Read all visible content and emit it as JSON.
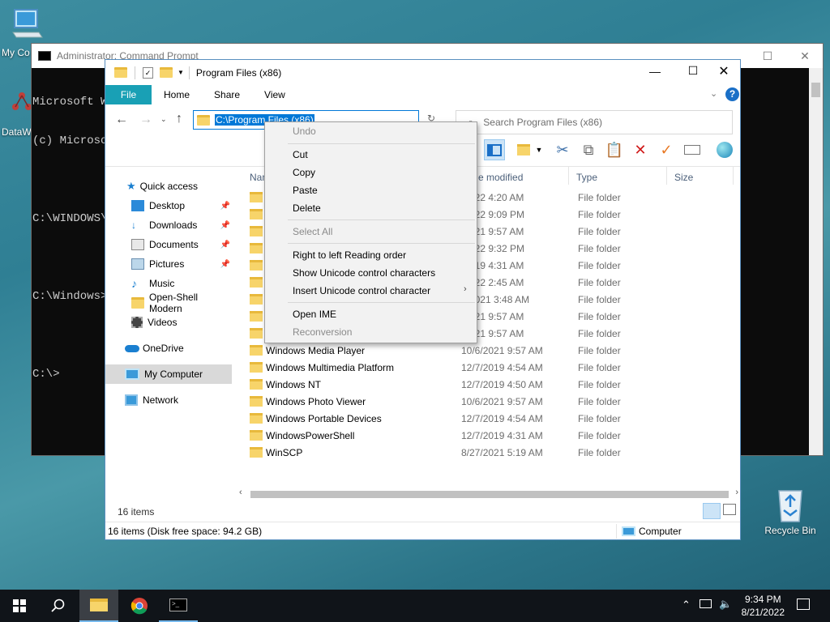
{
  "desktop": {
    "icons": [
      {
        "label": "My Co"
      },
      {
        "label": "DataW"
      },
      {
        "label": "Recycle Bin"
      }
    ]
  },
  "cmd": {
    "title": "Administrator: Command Prompt",
    "lines": [
      "Microsoft W",
      "(c) Microso",
      "",
      "C:\\WINDOWS\\s",
      "",
      "C:\\Windows>c",
      "",
      "C:\\>"
    ]
  },
  "explorer": {
    "title": "Program Files (x86)",
    "tabs": [
      "File",
      "Home",
      "Share",
      "View"
    ],
    "address_text": "C:\\Program Files (x86)",
    "search_placeholder": "Search Program Files (x86)",
    "columns": {
      "name": "Nam",
      "date": "e modified",
      "type": "Type",
      "size": "Size"
    },
    "nav": [
      {
        "label": "Quick access"
      },
      {
        "label": "Desktop",
        "pinned": true
      },
      {
        "label": "Downloads",
        "pinned": true
      },
      {
        "label": "Documents",
        "pinned": true
      },
      {
        "label": "Pictures",
        "pinned": true
      },
      {
        "label": "Music"
      },
      {
        "label": "Open-Shell Modern"
      },
      {
        "label": "Videos"
      },
      {
        "label": "OneDrive"
      },
      {
        "label": "My Computer"
      },
      {
        "label": "Network"
      }
    ],
    "files": [
      {
        "name": "",
        "date": "/2022 4:20 AM",
        "type": "File folder"
      },
      {
        "name": "",
        "date": "/2022 9:09 PM",
        "type": "File folder"
      },
      {
        "name": "",
        "date": "/2021 9:57 AM",
        "type": "File folder"
      },
      {
        "name": "",
        "date": "/2022 9:32 PM",
        "type": "File folder"
      },
      {
        "name": "",
        "date": "/2019 4:31 AM",
        "type": "File folder"
      },
      {
        "name": "",
        "date": "/2022 2:45 AM",
        "type": "File folder"
      },
      {
        "name": "",
        "date": "4/2021 3:48 AM",
        "type": "File folder"
      },
      {
        "name": "",
        "date": "/2021 9:57 AM",
        "type": "File folder"
      },
      {
        "name": "",
        "date": "/2021 9:57 AM",
        "type": "File folder"
      },
      {
        "name": "Windows Media Player",
        "date": "10/6/2021 9:57 AM",
        "type": "File folder"
      },
      {
        "name": "Windows Multimedia Platform",
        "date": "12/7/2019 4:54 AM",
        "type": "File folder"
      },
      {
        "name": "Windows NT",
        "date": "12/7/2019 4:50 AM",
        "type": "File folder"
      },
      {
        "name": "Windows Photo Viewer",
        "date": "10/6/2021 9:57 AM",
        "type": "File folder"
      },
      {
        "name": "Windows Portable Devices",
        "date": "12/7/2019 4:54 AM",
        "type": "File folder"
      },
      {
        "name": "WindowsPowerShell",
        "date": "12/7/2019 4:31 AM",
        "type": "File folder"
      },
      {
        "name": "WinSCP",
        "date": "8/27/2021 5:19 AM",
        "type": "File folder"
      }
    ],
    "item_count": "16 items",
    "status_left": "16 items (Disk free space: 94.2 GB)",
    "status_right": "Computer"
  },
  "context_menu": {
    "items": [
      {
        "label": "Undo",
        "disabled": true
      },
      {
        "label": "Cut"
      },
      {
        "label": "Copy"
      },
      {
        "label": "Paste"
      },
      {
        "label": "Delete"
      },
      {
        "label": "Select All",
        "disabled": true
      },
      {
        "label": "Right to left Reading order"
      },
      {
        "label": "Show Unicode control characters"
      },
      {
        "label": "Insert Unicode control character",
        "submenu": true
      },
      {
        "label": "Open IME"
      },
      {
        "label": "Reconversion",
        "disabled": true
      }
    ]
  },
  "taskbar": {
    "time": "9:34 PM",
    "date": "8/21/2022"
  }
}
